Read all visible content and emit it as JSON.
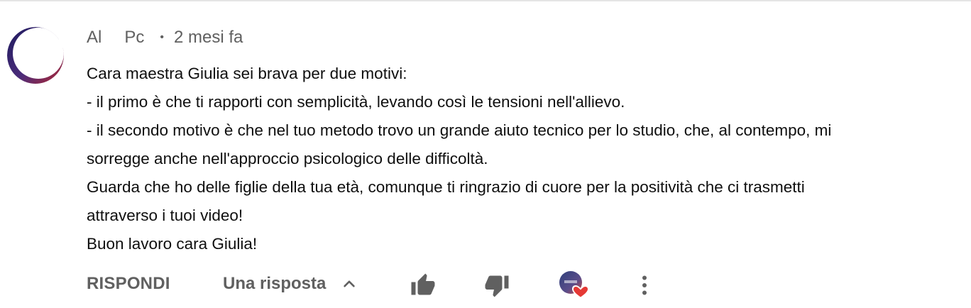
{
  "comment": {
    "author_first": "Al",
    "author_second": "Pc",
    "separator": "•",
    "timestamp": "2 mesi fa",
    "lines": [
      "Cara maestra Giulia sei brava per due motivi:",
      "- il primo è che ti rapporti con semplicità, levando così le tensioni nell'allievo.",
      "- il secondo motivo è che nel tuo metodo trovo un grande aiuto tecnico per lo studio, che, al contempo, mi",
      "sorregge anche nell'approccio psicologico delle difficoltà.",
      "Guarda che ho delle figlie della tua età, comunque ti ringrazio di cuore per la positività che ci trasmetti",
      "attraverso i tuoi video!",
      "Buon lavoro cara Giulia!"
    ]
  },
  "actions": {
    "reply_label": "RISPONDI",
    "replies_label": "Una risposta",
    "icons": {
      "like": "thumbs-up-icon",
      "dislike": "thumbs-down-icon",
      "creator_heart": "creator-heart-icon",
      "more": "more-vertical-icon",
      "expand": "chevron-up-icon"
    }
  },
  "colors": {
    "secondary_text": "#606060",
    "primary_text": "#0f0f0f",
    "heart": "#e53935",
    "avatar_accent": "#3f3a8c"
  }
}
